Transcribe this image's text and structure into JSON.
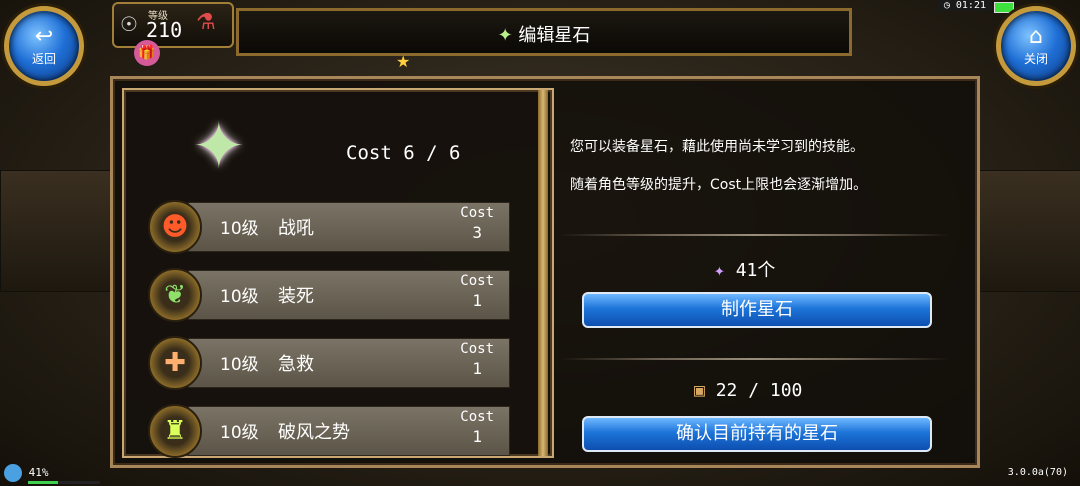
{
  "back_button": {
    "label": "返回",
    "icon": "back-arrow-icon"
  },
  "close_button": {
    "label": "关闭",
    "icon": "home-icon"
  },
  "player": {
    "level_label": "等级",
    "level": "210"
  },
  "status": {
    "time": "01:21",
    "battery_color": "#3ee03e"
  },
  "title": "编辑星石",
  "cost_summary": "Cost 6 / 6",
  "skills": [
    {
      "level": "10级",
      "name": "战吼",
      "cost_label": "Cost",
      "cost": "3",
      "icon": "war-cry-icon"
    },
    {
      "level": "10级",
      "name": "装死",
      "cost_label": "Cost",
      "cost": "1",
      "icon": "play-dead-icon"
    },
    {
      "level": "10级",
      "name": "急救",
      "cost_label": "Cost",
      "cost": "1",
      "icon": "first-aid-icon"
    },
    {
      "level": "10级",
      "name": "破风之势",
      "cost_label": "Cost",
      "cost": "1",
      "icon": "wind-break-icon"
    }
  ],
  "description": {
    "line1": "您可以装备星石，藉此使用尚未学习到的技能。",
    "line2": "随着角色等级的提升，Cost上限也会逐渐增加。"
  },
  "star_stone_count": "41个",
  "make_button_label": "制作星石",
  "held_count": "22 / 100",
  "confirm_button_label": "确认目前持有的星石",
  "footer": {
    "exp_percent": "41%",
    "exp_fraction": 0.41,
    "version": "3.0.0a(70)"
  },
  "colors": {
    "accent_blue": "#1d74d8",
    "frame_gold": "#c59a3c"
  }
}
